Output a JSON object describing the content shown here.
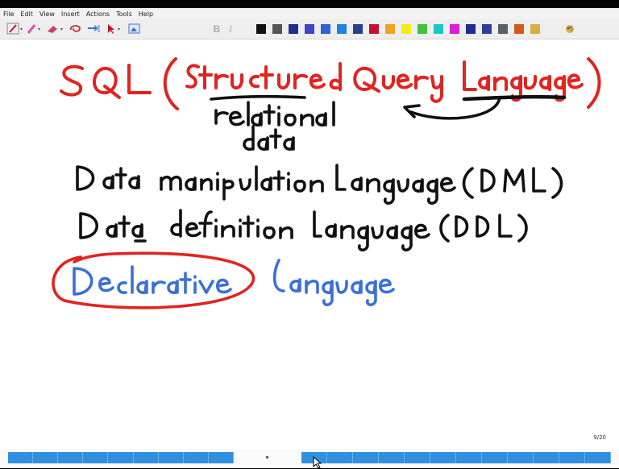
{
  "menu": {
    "items": [
      "File",
      "Edit",
      "View",
      "Insert",
      "Actions",
      "Tools",
      "Help"
    ]
  },
  "toolbar": {
    "tools": [
      "pen-tool",
      "highlighter-tool",
      "eraser-tool",
      "lasso-tool",
      "shape-tool",
      "insert-space-tool",
      "image-tool"
    ],
    "format_bold": "B",
    "format_italic": "I",
    "colors": [
      "#111111",
      "#555555",
      "#1c2f8f",
      "#3b47c5",
      "#2a64d6",
      "#1e82e0",
      "#23418f",
      "#c8102e",
      "#f4a21d",
      "#f5ea1a",
      "#43c23b",
      "#19c7c7",
      "#d61fd6",
      "#1d2f8f",
      "#2b3e9a",
      "#55616b",
      "#d6591c",
      "#d8b040"
    ]
  },
  "page": {
    "counter": "9/20",
    "ink": {
      "title_red": "SQL (Structured Query Language)",
      "note_black_1": "relational",
      "note_black_2": "data",
      "line_dml": "Data manipulation language (DML)",
      "line_ddl": "Data definition language (DDL)",
      "circled_blue": "Declarative",
      "tail_blue": "language"
    },
    "colors": {
      "red_ink": "#e0241f",
      "black_ink": "#111111",
      "blue_ink": "#3b6fd8"
    }
  },
  "status": {
    "page_dot": "·"
  }
}
